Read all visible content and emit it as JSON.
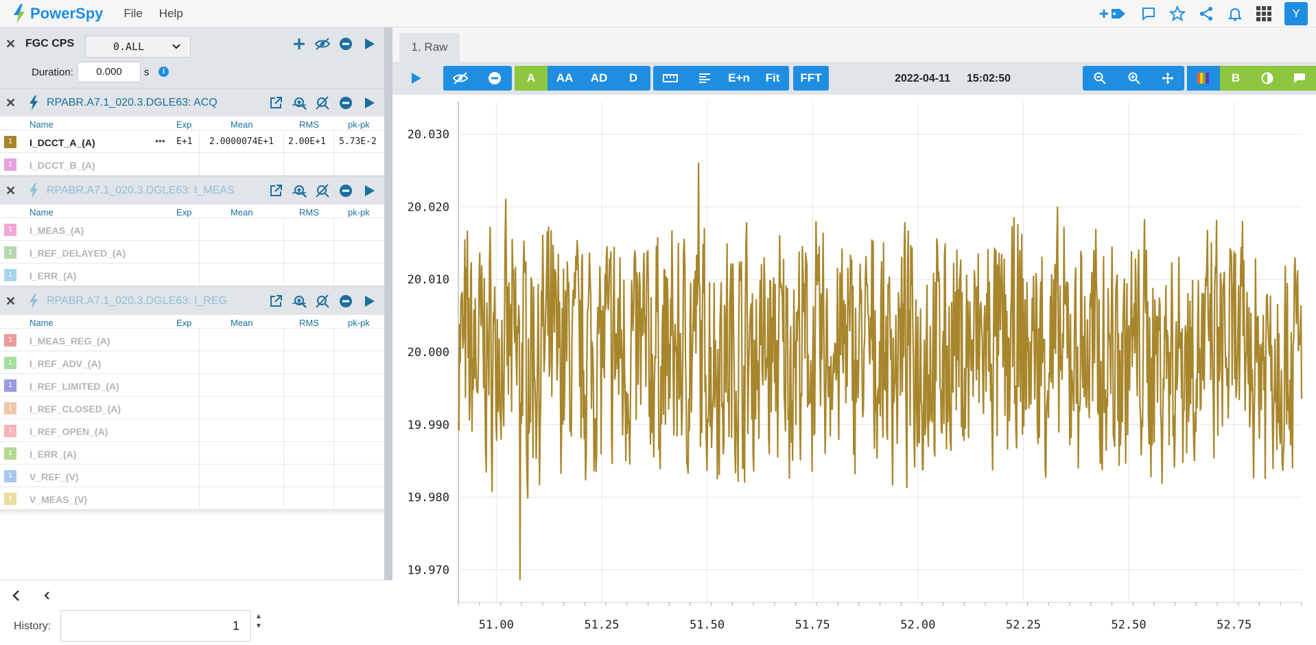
{
  "app": {
    "name": "PowerSpy",
    "menu": [
      "File",
      "Help"
    ]
  },
  "top_icons": [
    "add-tag-icon",
    "comment-icon",
    "star-icon",
    "share-icon",
    "bell-icon",
    "apps-grid-icon"
  ],
  "user": {
    "initial": "Y"
  },
  "device": {
    "label": "FGC CPS",
    "selector": "0.ALL",
    "duration_label": "Duration:",
    "duration_value": "0.000",
    "duration_unit": "s"
  },
  "table_headers": {
    "name": "Name",
    "exp": "Exp",
    "mean": "Mean",
    "rms": "RMS",
    "pkpk": "pk-pk"
  },
  "groups": [
    {
      "title": "RPABR.A7.1_020.3.DGLE63: ACQ",
      "signals": [
        {
          "name": "I_DCCT_A_(A)",
          "color": "#a8862c",
          "active": true,
          "exp": "E+1",
          "mean": "2.0000074E+1",
          "rms": "2.00E+1",
          "pkpk": "5.73E-2"
        },
        {
          "name": "I_DCCT_B_(A)",
          "color": "#e8a2e0",
          "active": false
        }
      ]
    },
    {
      "title": "RPABR.A7.1_020.3.DGLE63: I_MEAS",
      "signals": [
        {
          "name": "I_MEAS_(A)",
          "color": "#f0a8d8",
          "active": false
        },
        {
          "name": "I_REF_DELAYED_(A)",
          "color": "#b6d6b0",
          "active": false
        },
        {
          "name": "I_ERR_(A)",
          "color": "#a8d4ea",
          "active": false
        }
      ]
    },
    {
      "title": "RPABR.A7.1_020.3.DGLE63: I_REG",
      "signals": [
        {
          "name": "I_MEAS_REG_(A)",
          "color": "#ec9a9a",
          "active": false
        },
        {
          "name": "I_REF_ADV_(A)",
          "color": "#a4e0a0",
          "active": false
        },
        {
          "name": "I_REF_LIMITED_(A)",
          "color": "#9a9ae0",
          "active": false
        },
        {
          "name": "I_REF_CLOSED_(A)",
          "color": "#f0c8a8",
          "active": false
        },
        {
          "name": "I_REF_OPEN_(A)",
          "color": "#f8b4b8",
          "active": false
        },
        {
          "name": "I_ERR_(A)",
          "color": "#b4d890",
          "active": false
        },
        {
          "name": "V_REF_(V)",
          "color": "#a8c8f0",
          "active": false
        },
        {
          "name": "V_MEAS_(V)",
          "color": "#e8dca0",
          "active": false
        }
      ]
    }
  ],
  "history": {
    "label": "History:",
    "value": "1"
  },
  "tab": {
    "label": "1. Raw"
  },
  "toolbar": {
    "modes": [
      "A",
      "AA",
      "AD",
      "D"
    ],
    "format": [
      "E+n",
      "Fit"
    ],
    "fft": "FFT",
    "b_label": "B",
    "date": "2022-04-11",
    "time": "15:02:50"
  },
  "chart_data": {
    "type": "line",
    "series": [
      {
        "color": "#a8862c"
      }
    ],
    "x_ticks": [
      "51.00",
      "51.25",
      "51.50",
      "51.75",
      "52.00",
      "52.25",
      "52.50",
      "52.75"
    ],
    "y_ticks": [
      "19.970",
      "19.980",
      "19.990",
      "20.000",
      "20.010",
      "20.020",
      "20.030"
    ],
    "xlim": [
      50.91,
      52.91
    ],
    "ylim": [
      19.9655,
      20.0345
    ],
    "y_mean": 20.0,
    "y_min": 19.9687,
    "y_max": 20.026,
    "grid": true
  }
}
